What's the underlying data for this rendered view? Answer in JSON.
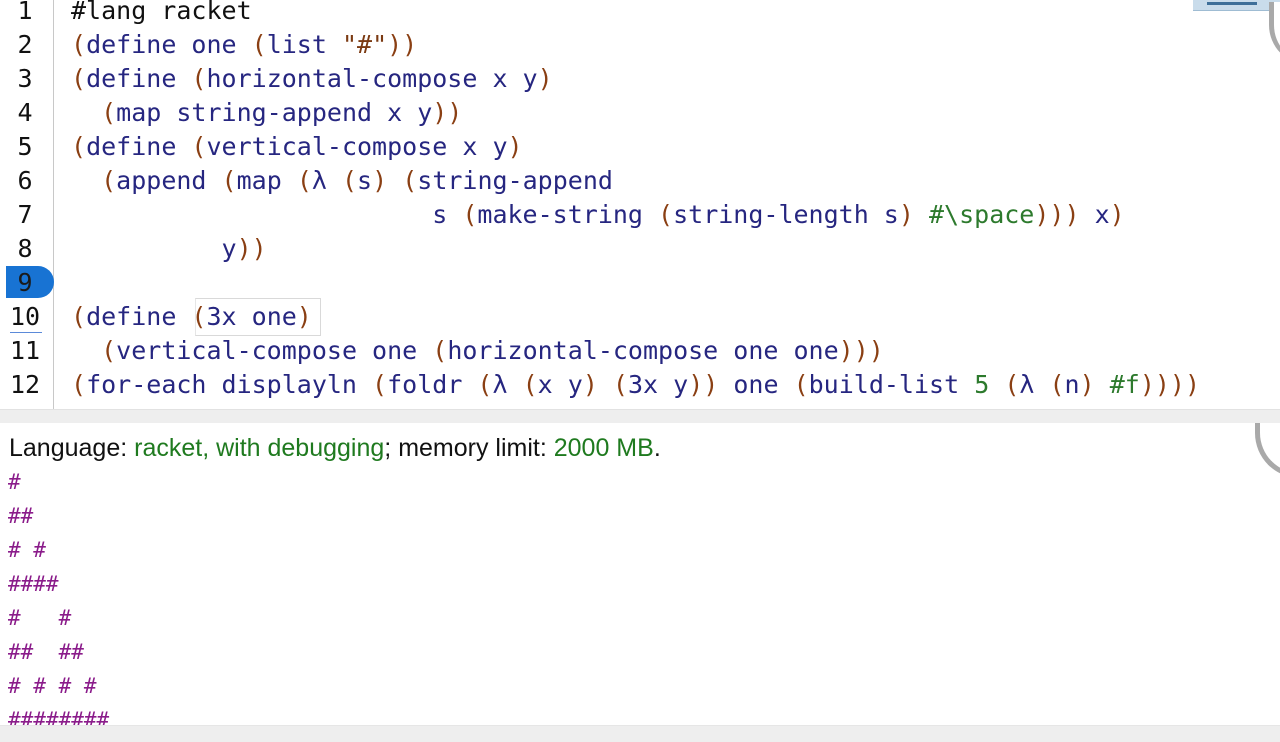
{
  "editor": {
    "line_numbers": [
      "1",
      "2",
      "3",
      "4",
      "5",
      "6",
      "7",
      "8",
      "9",
      "10",
      "11",
      "12"
    ],
    "breakpoint_line": "9",
    "lines": [
      [
        {
          "t": "#lang racket",
          "c": "cm"
        }
      ],
      [
        {
          "t": "(",
          "c": "p"
        },
        {
          "t": "define one ",
          "c": "k"
        },
        {
          "t": "(",
          "c": "p"
        },
        {
          "t": "list ",
          "c": "k"
        },
        {
          "t": "\"#\"",
          "c": "s"
        },
        {
          "t": "))",
          "c": "p"
        }
      ],
      [
        {
          "t": "(",
          "c": "p"
        },
        {
          "t": "define ",
          "c": "k"
        },
        {
          "t": "(",
          "c": "p"
        },
        {
          "t": "horizontal-compose x y",
          "c": "k"
        },
        {
          "t": ")",
          "c": "p"
        }
      ],
      [
        {
          "t": "  ",
          "c": "k"
        },
        {
          "t": "(",
          "c": "p"
        },
        {
          "t": "map string-append x y",
          "c": "k"
        },
        {
          "t": "))",
          "c": "p"
        }
      ],
      [
        {
          "t": "(",
          "c": "p"
        },
        {
          "t": "define ",
          "c": "k"
        },
        {
          "t": "(",
          "c": "p"
        },
        {
          "t": "vertical-compose x y",
          "c": "k"
        },
        {
          "t": ")",
          "c": "p"
        }
      ],
      [
        {
          "t": "  ",
          "c": "k"
        },
        {
          "t": "(",
          "c": "p"
        },
        {
          "t": "append ",
          "c": "k"
        },
        {
          "t": "(",
          "c": "p"
        },
        {
          "t": "map ",
          "c": "k"
        },
        {
          "t": "(",
          "c": "p"
        },
        {
          "t": "λ ",
          "c": "k"
        },
        {
          "t": "(",
          "c": "p"
        },
        {
          "t": "s",
          "c": "k"
        },
        {
          "t": ") (",
          "c": "p"
        },
        {
          "t": "string-append",
          "c": "k"
        }
      ],
      [
        {
          "t": "                        s ",
          "c": "k"
        },
        {
          "t": "(",
          "c": "p"
        },
        {
          "t": "make-string ",
          "c": "k"
        },
        {
          "t": "(",
          "c": "p"
        },
        {
          "t": "string-length s",
          "c": "k"
        },
        {
          "t": ") ",
          "c": "p"
        },
        {
          "t": "#\\space",
          "c": "n"
        },
        {
          "t": "))) ",
          "c": "p"
        },
        {
          "t": "x",
          "c": "k"
        },
        {
          "t": ")",
          "c": "p"
        }
      ],
      [
        {
          "t": "          y",
          "c": "k"
        },
        {
          "t": "))",
          "c": "p"
        }
      ],
      [],
      [
        {
          "t": "(",
          "c": "p"
        },
        {
          "t": "define ",
          "c": "k"
        },
        {
          "t": "(",
          "c": "p"
        },
        {
          "t": "3x one",
          "c": "k"
        },
        {
          "t": ")",
          "c": "p"
        }
      ],
      [
        {
          "t": "  ",
          "c": "k"
        },
        {
          "t": "(",
          "c": "p"
        },
        {
          "t": "vertical-compose one ",
          "c": "k"
        },
        {
          "t": "(",
          "c": "p"
        },
        {
          "t": "horizontal-compose one one",
          "c": "k"
        },
        {
          "t": ")))",
          "c": "p"
        }
      ],
      [
        {
          "t": "(",
          "c": "p"
        },
        {
          "t": "for-each displayln ",
          "c": "k"
        },
        {
          "t": "(",
          "c": "p"
        },
        {
          "t": "foldr ",
          "c": "k"
        },
        {
          "t": "(",
          "c": "p"
        },
        {
          "t": "λ ",
          "c": "k"
        },
        {
          "t": "(",
          "c": "p"
        },
        {
          "t": "x y",
          "c": "k"
        },
        {
          "t": ") (",
          "c": "p"
        },
        {
          "t": "3x y",
          "c": "k"
        },
        {
          "t": ")) ",
          "c": "p"
        },
        {
          "t": "one ",
          "c": "k"
        },
        {
          "t": "(",
          "c": "p"
        },
        {
          "t": "build-list ",
          "c": "k"
        },
        {
          "t": "5 ",
          "c": "n"
        },
        {
          "t": "(",
          "c": "p"
        },
        {
          "t": "λ ",
          "c": "k"
        },
        {
          "t": "(",
          "c": "p"
        },
        {
          "t": "n",
          "c": "k"
        },
        {
          "t": ") ",
          "c": "p"
        },
        {
          "t": "#f",
          "c": "n"
        },
        {
          "t": "))))",
          "c": "p"
        }
      ]
    ]
  },
  "interactions": {
    "lang_label": "Language: ",
    "lang_value": "racket, with debugging",
    "sep": "; memory limit: ",
    "mem_value": "2000 MB",
    "period": ".",
    "output": [
      "#",
      "##",
      "# #",
      "####",
      "#   #",
      "##  ##",
      "# # # #",
      "########"
    ]
  },
  "colors": {
    "keyword": "#262680",
    "paren": "#8a3f13",
    "string": "#7b3a12",
    "constant": "#2d7a2d",
    "output": "#8a1b8a",
    "breakpoint": "#1873d3"
  }
}
